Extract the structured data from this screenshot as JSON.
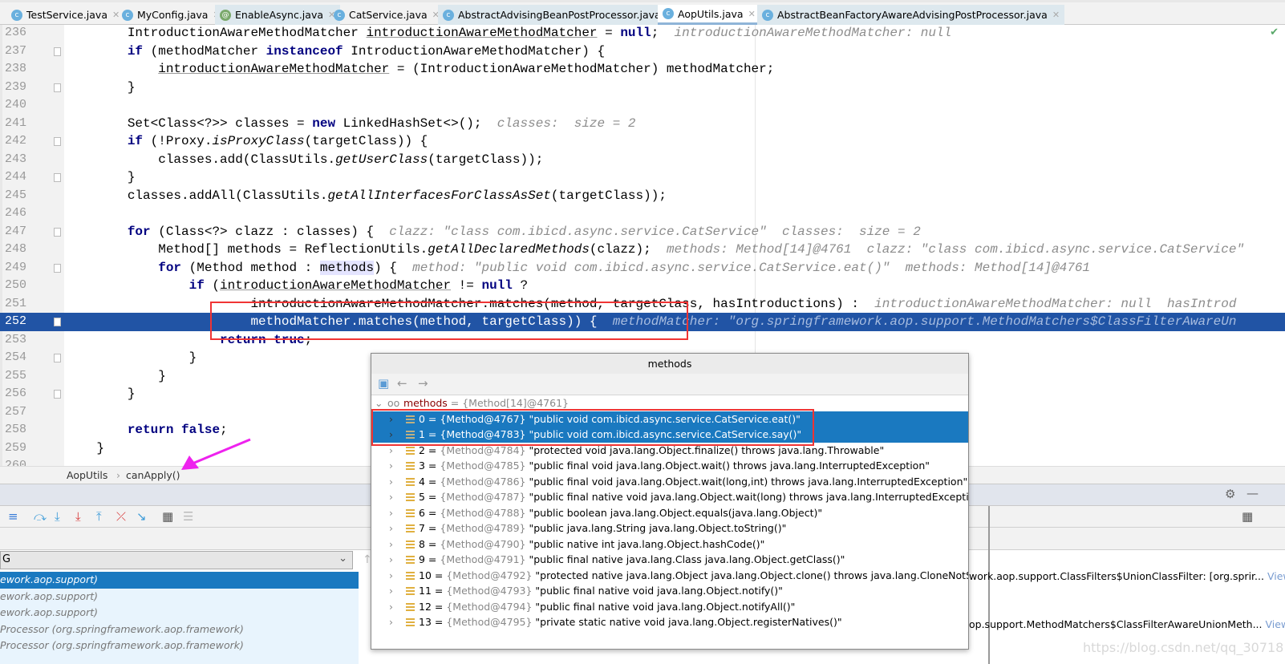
{
  "tabs": [
    {
      "label": "TestService.java",
      "icon": "class-icon"
    },
    {
      "label": "MyConfig.java",
      "icon": "class-icon"
    },
    {
      "label": "EnableAsync.java",
      "icon": "annotation-icon"
    },
    {
      "label": "CatService.java",
      "icon": "class-icon"
    },
    {
      "label": "AbstractAdvisingBeanPostProcessor.java",
      "icon": "class-icon"
    },
    {
      "label": "AopUtils.java",
      "icon": "class-icon",
      "active": true
    },
    {
      "label": "AbstractBeanFactoryAwareAdvisingPostProcessor.java",
      "icon": "class-icon"
    }
  ],
  "editor": {
    "current_line": "252",
    "lines": [
      {
        "n": "236",
        "s": [
          [
            "",
            "        IntroductionAwareMethodMatcher "
          ],
          [
            "u",
            "introductionAwareMethodMatcher"
          ],
          [
            "",
            " = "
          ],
          [
            "k",
            "null"
          ],
          [
            "",
            ";"
          ],
          [
            "h",
            "  introductionAwareMethodMatcher: null"
          ]
        ]
      },
      {
        "n": "237",
        "s": [
          [
            "",
            "        "
          ],
          [
            "k",
            "if"
          ],
          [
            "",
            " (methodMatcher "
          ],
          [
            "k",
            "instanceof"
          ],
          [
            "",
            " IntroductionAwareMethodMatcher) {"
          ]
        ]
      },
      {
        "n": "238",
        "s": [
          [
            "",
            "            "
          ],
          [
            "u",
            "introductionAwareMethodMatcher"
          ],
          [
            "",
            " = (IntroductionAwareMethodMatcher) methodMatcher;"
          ]
        ]
      },
      {
        "n": "239",
        "s": [
          [
            "",
            "        }"
          ]
        ]
      },
      {
        "n": "240",
        "s": []
      },
      {
        "n": "241",
        "s": [
          [
            "",
            "        Set<Class<?>> classes = "
          ],
          [
            "k",
            "new"
          ],
          [
            "",
            " LinkedHashSet<>();"
          ],
          [
            "h",
            "  classes:  size = 2"
          ]
        ]
      },
      {
        "n": "242",
        "s": [
          [
            "",
            "        "
          ],
          [
            "k",
            "if"
          ],
          [
            "",
            " (!Proxy."
          ],
          [
            "i",
            "isProxyClass"
          ],
          [
            "",
            "(targetClass)) {"
          ]
        ]
      },
      {
        "n": "243",
        "s": [
          [
            "",
            "            classes.add(ClassUtils."
          ],
          [
            "i",
            "getUserClass"
          ],
          [
            "",
            "(targetClass));"
          ]
        ]
      },
      {
        "n": "244",
        "s": [
          [
            "",
            "        }"
          ]
        ]
      },
      {
        "n": "245",
        "s": [
          [
            "",
            "        classes.addAll(ClassUtils."
          ],
          [
            "i",
            "getAllInterfacesForClassAsSet"
          ],
          [
            "",
            "(targetClass));"
          ]
        ]
      },
      {
        "n": "246",
        "s": []
      },
      {
        "n": "247",
        "s": [
          [
            "",
            "        "
          ],
          [
            "k",
            "for"
          ],
          [
            "",
            " (Class<?> clazz : classes) {"
          ],
          [
            "h",
            "  clazz: \"class com.ibicd.async.service.CatService\"  classes:  size = 2"
          ]
        ]
      },
      {
        "n": "248",
        "s": [
          [
            "",
            "            Method[] methods = ReflectionUtils."
          ],
          [
            "i",
            "getAllDeclaredMethods"
          ],
          [
            "",
            "(clazz);"
          ],
          [
            "h",
            "  methods: Method[14]@4761  clazz: \"class com.ibicd.async.service.CatService\""
          ]
        ]
      },
      {
        "n": "249",
        "s": [
          [
            "",
            "            "
          ],
          [
            "k",
            "for"
          ],
          [
            "",
            " (Method method : "
          ],
          [
            "hl",
            "methods"
          ],
          [
            "",
            ") {"
          ],
          [
            "h",
            "  method: \"public void com.ibicd.async.service.CatService.eat()\"  methods: Method[14]@4761"
          ]
        ]
      },
      {
        "n": "250",
        "s": [
          [
            "",
            "                "
          ],
          [
            "k",
            "if"
          ],
          [
            "",
            " ("
          ],
          [
            "u",
            "introductionAwareMethodMatcher"
          ],
          [
            "",
            " != "
          ],
          [
            "k",
            "null"
          ],
          [
            "",
            " ?"
          ]
        ]
      },
      {
        "n": "251",
        "s": [
          [
            "",
            "                        introductionAwareMethodMatcher.matches(method, targetClass, hasIntroductions) :"
          ],
          [
            "h",
            "  introductionAwareMethodMatcher: null  hasIntrod"
          ]
        ]
      },
      {
        "n": "252",
        "s": [
          [
            "",
            "                        methodMatcher.matches(method, targetClass)) {"
          ],
          [
            "h",
            "  methodMatcher: \"org.springframework.aop.support.MethodMatchers$ClassFilterAwareUn"
          ]
        ]
      },
      {
        "n": "253",
        "s": [
          [
            "",
            "                    "
          ],
          [
            "k",
            "return"
          ],
          [
            "",
            " "
          ],
          [
            "k",
            "true"
          ],
          [
            "",
            ";"
          ]
        ]
      },
      {
        "n": "254",
        "s": [
          [
            "",
            "                }"
          ]
        ]
      },
      {
        "n": "255",
        "s": [
          [
            "",
            "            }"
          ]
        ]
      },
      {
        "n": "256",
        "s": [
          [
            "",
            "        }"
          ]
        ]
      },
      {
        "n": "257",
        "s": []
      },
      {
        "n": "258",
        "s": [
          [
            "",
            "        "
          ],
          [
            "k",
            "return"
          ],
          [
            "",
            " "
          ],
          [
            "k",
            "false"
          ],
          [
            "",
            ";"
          ]
        ]
      },
      {
        "n": "259",
        "s": [
          [
            "",
            "    }"
          ]
        ]
      },
      {
        "n": "260",
        "s": []
      }
    ]
  },
  "breadcrumb": {
    "class": "AopUtils",
    "sep": "›",
    "method": "canApply()"
  },
  "debug": {
    "dropdown_value": "G",
    "frames": [
      "ework.aop.support)",
      "ework.aop.support)",
      "ework.aop.support)",
      "Processor (org.springframework.aop.framework)",
      "Processor (org.springframework.aop.framework)"
    ],
    "variables": [
      {
        "text": "work.aop.support.ClassFilters$UnionClassFilter: [org.sprir...",
        "link": "View"
      },
      {
        "text": "op.support.MethodMatchers$ClassFilterAwareUnionMeth...",
        "link": "View"
      }
    ]
  },
  "popup": {
    "title": "methods",
    "root": {
      "name": "methods",
      "value": "= {Method[14]@4761}"
    },
    "rows": [
      {
        "idx": "0",
        "ref": "{Method@4767}",
        "val": "\"public void com.ibicd.async.service.CatService.eat()\"",
        "sel": true
      },
      {
        "idx": "1",
        "ref": "{Method@4783}",
        "val": "\"public void com.ibicd.async.service.CatService.say()\"",
        "sel": true
      },
      {
        "idx": "2",
        "ref": "{Method@4784}",
        "val": "\"protected void java.lang.Object.finalize() throws java.lang.Throwable\""
      },
      {
        "idx": "3",
        "ref": "{Method@4785}",
        "val": "\"public final void java.lang.Object.wait() throws java.lang.InterruptedException\""
      },
      {
        "idx": "4",
        "ref": "{Method@4786}",
        "val": "\"public final void java.lang.Object.wait(long,int) throws java.lang.InterruptedException\""
      },
      {
        "idx": "5",
        "ref": "{Method@4787}",
        "val": "\"public final native void java.lang.Object.wait(long) throws java.lang.InterruptedException\""
      },
      {
        "idx": "6",
        "ref": "{Method@4788}",
        "val": "\"public boolean java.lang.Object.equals(java.lang.Object)\""
      },
      {
        "idx": "7",
        "ref": "{Method@4789}",
        "val": "\"public java.lang.String java.lang.Object.toString()\""
      },
      {
        "idx": "8",
        "ref": "{Method@4790}",
        "val": "\"public native int java.lang.Object.hashCode()\""
      },
      {
        "idx": "9",
        "ref": "{Method@4791}",
        "val": "\"public final native java.lang.Class java.lang.Object.getClass()\""
      },
      {
        "idx": "10",
        "ref": "{Method@4792}",
        "val": "\"protected native java.lang.Object java.lang.Object.clone() throws java.lang.CloneNotSupportedExc"
      },
      {
        "idx": "11",
        "ref": "{Method@4793}",
        "val": "\"public final native void java.lang.Object.notify()\""
      },
      {
        "idx": "12",
        "ref": "{Method@4794}",
        "val": "\"public final native void java.lang.Object.notifyAll()\""
      },
      {
        "idx": "13",
        "ref": "{Method@4795}",
        "val": "\"private static native void java.lang.Object.registerNatives()\""
      }
    ]
  },
  "watermark": "https://blog.csdn.net/qq_30718137",
  "colors": {
    "current_line": "#2154a5",
    "selection": "#1a79c0",
    "highlight_box": "#f03434",
    "arrow": "#ee22ee"
  }
}
